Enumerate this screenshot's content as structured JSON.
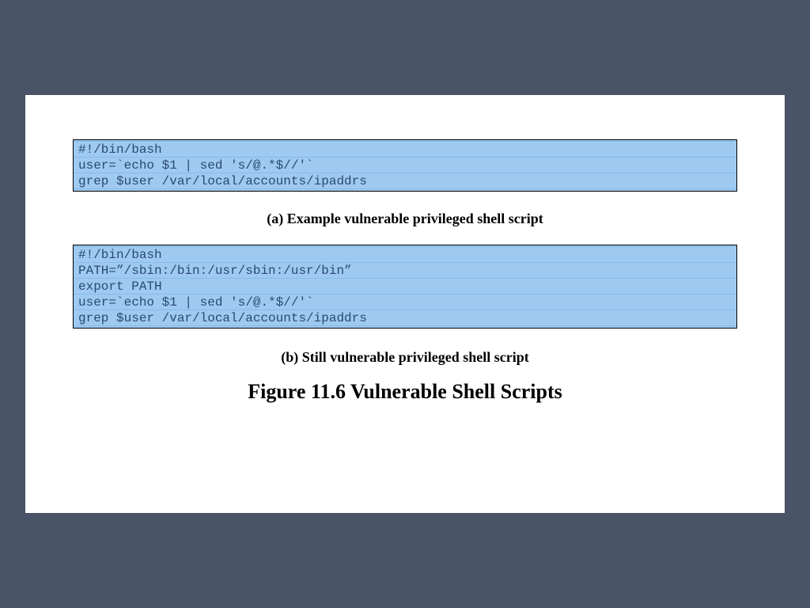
{
  "codeA": "#!/bin/bash\nuser=`echo $1 | sed 's/@.*$//'`\ngrep $user /var/local/accounts/ipaddrs",
  "captionA": "(a) Example vulnerable privileged shell script",
  "codeB": "#!/bin/bash\nPATH=”/sbin:/bin:/usr/sbin:/usr/bin”\nexport PATH\nuser=`echo $1 | sed 's/@.*$//'`\ngrep $user /var/local/accounts/ipaddrs",
  "captionB": "(b)  Still vulnerable privileged shell script",
  "figure": "Figure 11.6  Vulnerable Shell Scripts"
}
